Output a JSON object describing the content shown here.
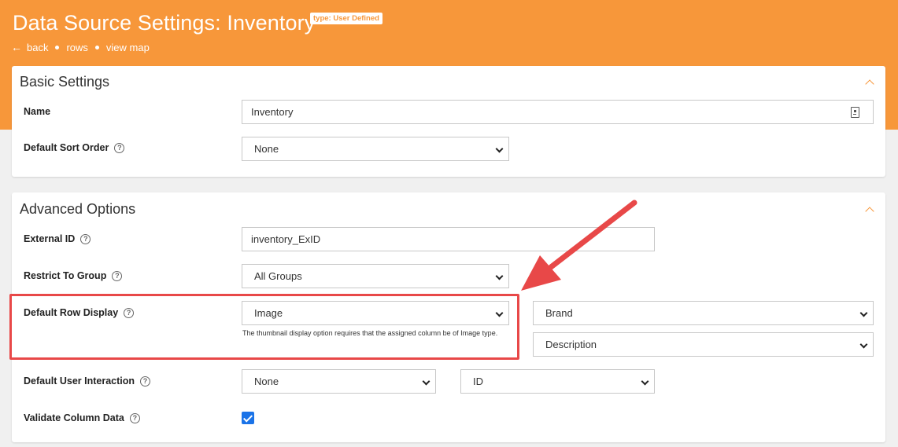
{
  "header": {
    "title": "Data Source Settings: Inventory",
    "type_badge": "type: User Defined",
    "nav": {
      "back": "back",
      "rows": "rows",
      "view_map": "view map"
    },
    "color": "#f7973a"
  },
  "basic_settings": {
    "title": "Basic Settings",
    "name_label": "Name",
    "name_value": "Inventory",
    "sort_label": "Default Sort Order",
    "sort_value": "None"
  },
  "advanced_options": {
    "title": "Advanced Options",
    "external_id_label": "External ID",
    "external_id_value": "inventory_ExID",
    "restrict_label": "Restrict To Group",
    "restrict_value": "All Groups",
    "row_display_label": "Default Row Display",
    "row_display_value": "Image",
    "row_display_hint": "The thumbnail display option requires that the assigned column be of Image type.",
    "brand_value": "Brand",
    "description_value": "Description",
    "interaction_label": "Default User Interaction",
    "interaction_value": "None",
    "interaction_column_value": "ID",
    "validate_label": "Validate Column Data",
    "validate_checked": true
  },
  "annotation_color": "#e84848",
  "icons": {
    "back": "arrow-left-icon",
    "help": "question-circle-icon",
    "collapse": "chevron-up-icon",
    "name_field": "contact-card-icon"
  }
}
